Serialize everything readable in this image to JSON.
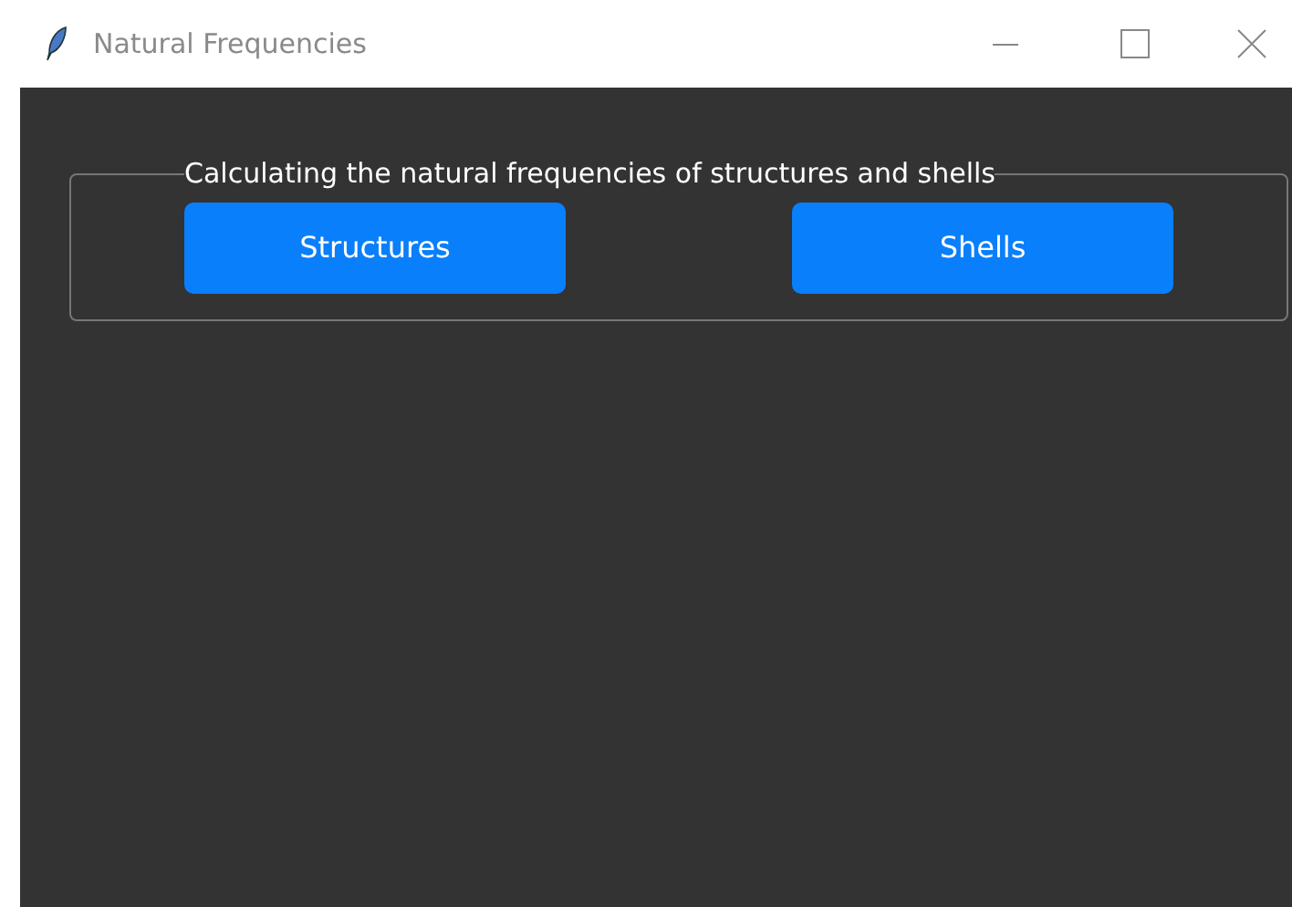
{
  "window": {
    "title": "Natural Frequencies"
  },
  "group": {
    "title": "Calculating the natural frequencies of structures and shells",
    "buttons": [
      {
        "label": "Structures"
      },
      {
        "label": "Shells"
      }
    ]
  }
}
